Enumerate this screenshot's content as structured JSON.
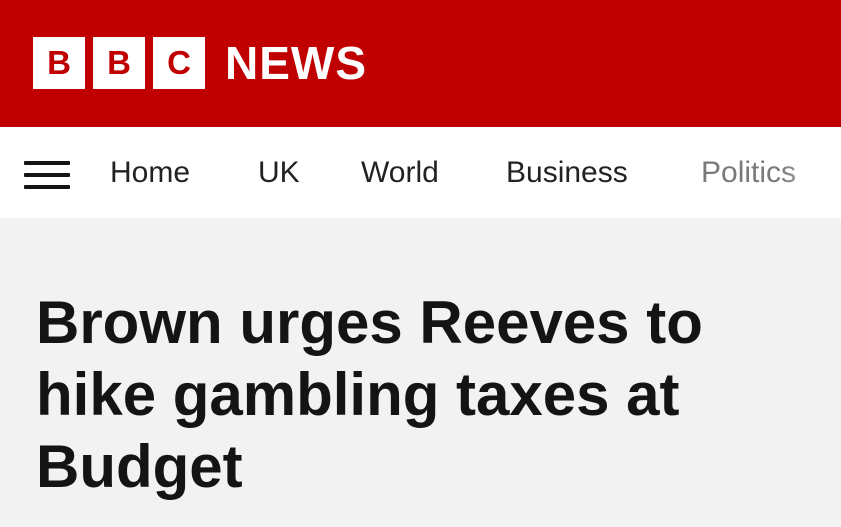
{
  "header": {
    "logo_letters": [
      "B",
      "B",
      "C"
    ],
    "logo_word": "NEWS",
    "brand_color": "#c00000"
  },
  "nav": {
    "menu_icon": "hamburger-menu-icon",
    "items": [
      {
        "label": "Home"
      },
      {
        "label": "UK"
      },
      {
        "label": "World"
      },
      {
        "label": "Business"
      },
      {
        "label": "Politics"
      }
    ]
  },
  "article": {
    "headline": "Brown urges Reeves to hike gambling taxes at Budget"
  }
}
